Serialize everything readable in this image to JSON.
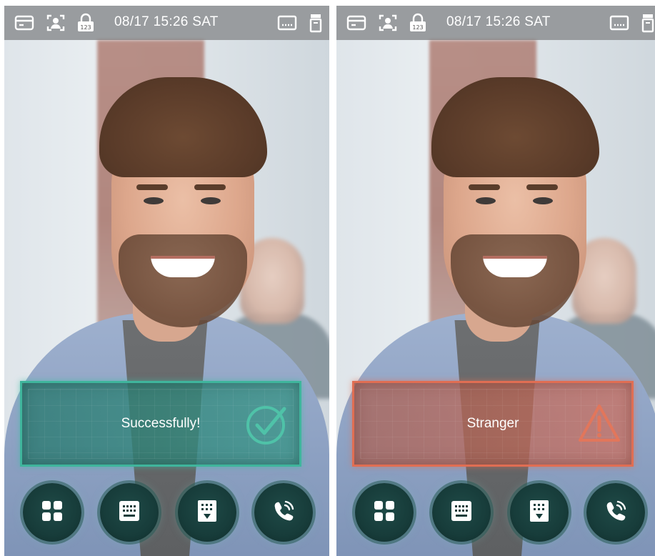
{
  "colors": {
    "success_accent": "#3fb59c",
    "stranger_accent": "#e06e53",
    "button_bg": "#173c3a"
  },
  "screens": [
    {
      "status_bar": {
        "datetime": "08/17 15:26  SAT",
        "icons": [
          "card-icon",
          "face-id-icon",
          "password-lock-icon",
          "keyboard-icon",
          "door-sensor-icon"
        ]
      },
      "result": {
        "text": "Successfully!",
        "state": "success",
        "icon": "check-circle-icon"
      },
      "bottom_buttons": [
        "menu-grid-icon",
        "keypad-icon",
        "door-keypad-icon",
        "call-icon"
      ]
    },
    {
      "status_bar": {
        "datetime": "08/17 15:26  SAT",
        "icons": [
          "card-icon",
          "face-id-icon",
          "password-lock-icon",
          "keyboard-icon",
          "door-sensor-icon"
        ]
      },
      "result": {
        "text": "Stranger",
        "state": "warning",
        "icon": "warning-triangle-icon"
      },
      "bottom_buttons": [
        "menu-grid-icon",
        "keypad-icon",
        "door-keypad-icon",
        "call-icon"
      ]
    }
  ]
}
